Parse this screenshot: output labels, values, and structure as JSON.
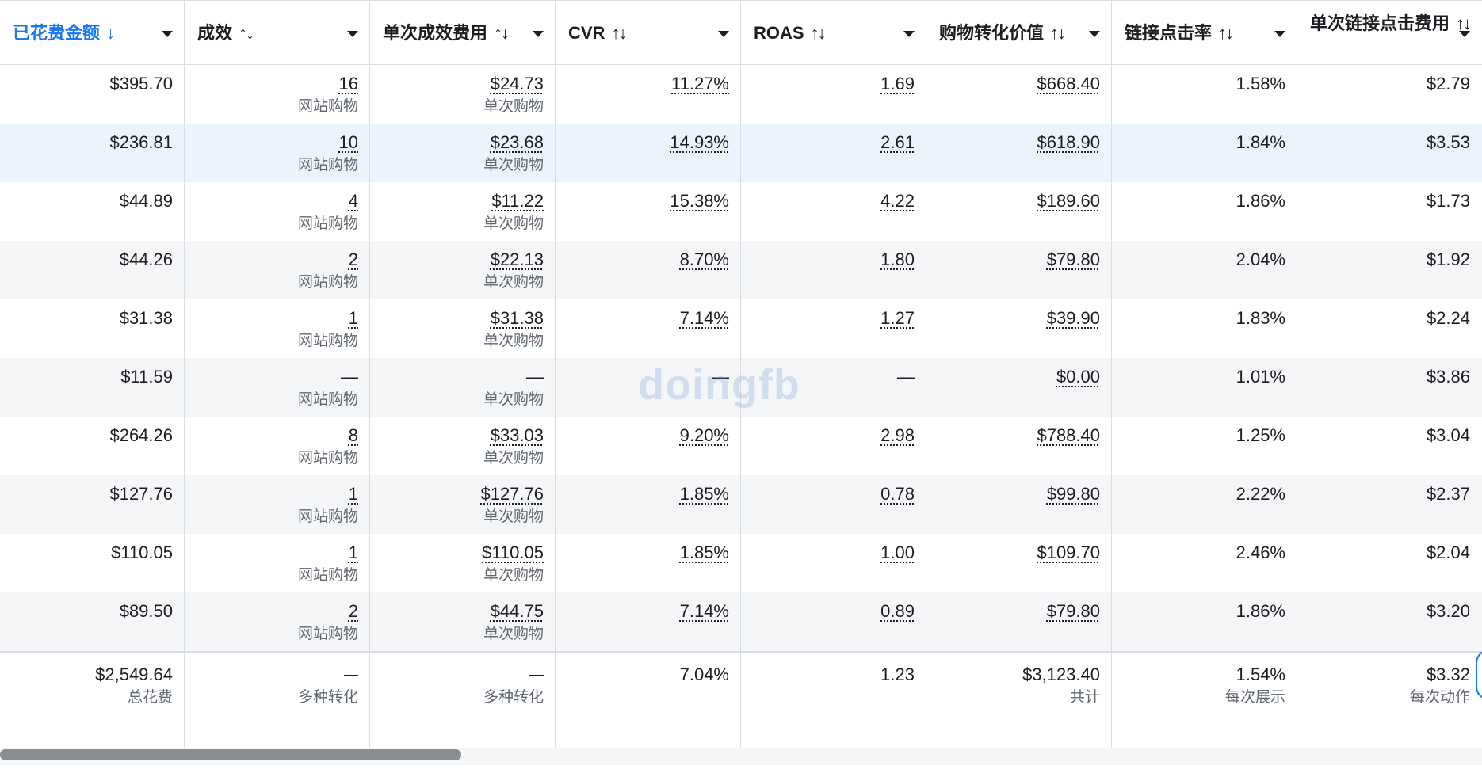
{
  "columns": [
    {
      "label": "已花费金额",
      "sort": "↓",
      "sorted": true
    },
    {
      "label": "成效",
      "sort": "↑↓",
      "sorted": false
    },
    {
      "label": "单次成效费用",
      "sort": "↑↓",
      "sorted": false
    },
    {
      "label": "CVR",
      "sort": "↑↓",
      "sorted": false
    },
    {
      "label": "ROAS",
      "sort": "↑↓",
      "sorted": false
    },
    {
      "label": "购物转化价值",
      "sort": "↑↓",
      "sorted": false
    },
    {
      "label": "链接点击率",
      "sort": "↑↓",
      "sorted": false
    },
    {
      "label": "单次链接点击费用",
      "sort": "↑↓",
      "sorted": false
    }
  ],
  "rows": [
    {
      "spend": "$395.70",
      "results": "16",
      "results_sub": "网站购物",
      "cpr": "$24.73",
      "cpr_sub": "单次购物",
      "cvr": "11.27%",
      "roas": "1.69",
      "value": "$668.40",
      "ctr": "1.58%",
      "cpc": "$2.79"
    },
    {
      "spend": "$236.81",
      "results": "10",
      "results_sub": "网站购物",
      "cpr": "$23.68",
      "cpr_sub": "单次购物",
      "cvr": "14.93%",
      "roas": "2.61",
      "value": "$618.90",
      "ctr": "1.84%",
      "cpc": "$3.53"
    },
    {
      "spend": "$44.89",
      "results": "4",
      "results_sub": "网站购物",
      "cpr": "$11.22",
      "cpr_sub": "单次购物",
      "cvr": "15.38%",
      "roas": "4.22",
      "value": "$189.60",
      "ctr": "1.86%",
      "cpc": "$1.73"
    },
    {
      "spend": "$44.26",
      "results": "2",
      "results_sub": "网站购物",
      "cpr": "$22.13",
      "cpr_sub": "单次购物",
      "cvr": "8.70%",
      "roas": "1.80",
      "value": "$79.80",
      "ctr": "2.04%",
      "cpc": "$1.92"
    },
    {
      "spend": "$31.38",
      "results": "1",
      "results_sub": "网站购物",
      "cpr": "$31.38",
      "cpr_sub": "单次购物",
      "cvr": "7.14%",
      "roas": "1.27",
      "value": "$39.90",
      "ctr": "1.83%",
      "cpc": "$2.24"
    },
    {
      "spend": "$11.59",
      "results": "—",
      "results_sub": "网站购物",
      "cpr": "—",
      "cpr_sub": "单次购物",
      "cvr": "—",
      "roas": "—",
      "value": "$0.00",
      "ctr": "1.01%",
      "cpc": "$3.86"
    },
    {
      "spend": "$264.26",
      "results": "8",
      "results_sub": "网站购物",
      "cpr": "$33.03",
      "cpr_sub": "单次购物",
      "cvr": "9.20%",
      "roas": "2.98",
      "value": "$788.40",
      "ctr": "1.25%",
      "cpc": "$3.04"
    },
    {
      "spend": "$127.76",
      "results": "1",
      "results_sub": "网站购物",
      "cpr": "$127.76",
      "cpr_sub": "单次购物",
      "cvr": "1.85%",
      "roas": "0.78",
      "value": "$99.80",
      "ctr": "2.22%",
      "cpc": "$2.37"
    },
    {
      "spend": "$110.05",
      "results": "1",
      "results_sub": "网站购物",
      "cpr": "$110.05",
      "cpr_sub": "单次购物",
      "cvr": "1.85%",
      "roas": "1.00",
      "value": "$109.70",
      "ctr": "2.46%",
      "cpc": "$2.04"
    },
    {
      "spend": "$89.50",
      "results": "2",
      "results_sub": "网站购物",
      "cpr": "$44.75",
      "cpr_sub": "单次购物",
      "cvr": "7.14%",
      "roas": "0.89",
      "value": "$79.80",
      "ctr": "1.86%",
      "cpc": "$3.20"
    }
  ],
  "highlighted_row": 1,
  "totals": {
    "spend": "$2,549.64",
    "spend_sub": "总花费",
    "results": "—",
    "results_sub": "多种转化",
    "cpr": "—",
    "cpr_sub": "多种转化",
    "cvr": "7.04%",
    "roas": "1.23",
    "value": "$3,123.40",
    "value_sub": "共计",
    "ctr": "1.54%",
    "ctr_sub": "每次展示",
    "cpc": "$3.32",
    "cpc_sub": "每次动作"
  },
  "watermark": "doingfb",
  "colors": {
    "accent": "#1877f2",
    "row_alt": "#f5f6f7",
    "row_highlight": "#ebf3fd",
    "border": "#dadde1"
  }
}
